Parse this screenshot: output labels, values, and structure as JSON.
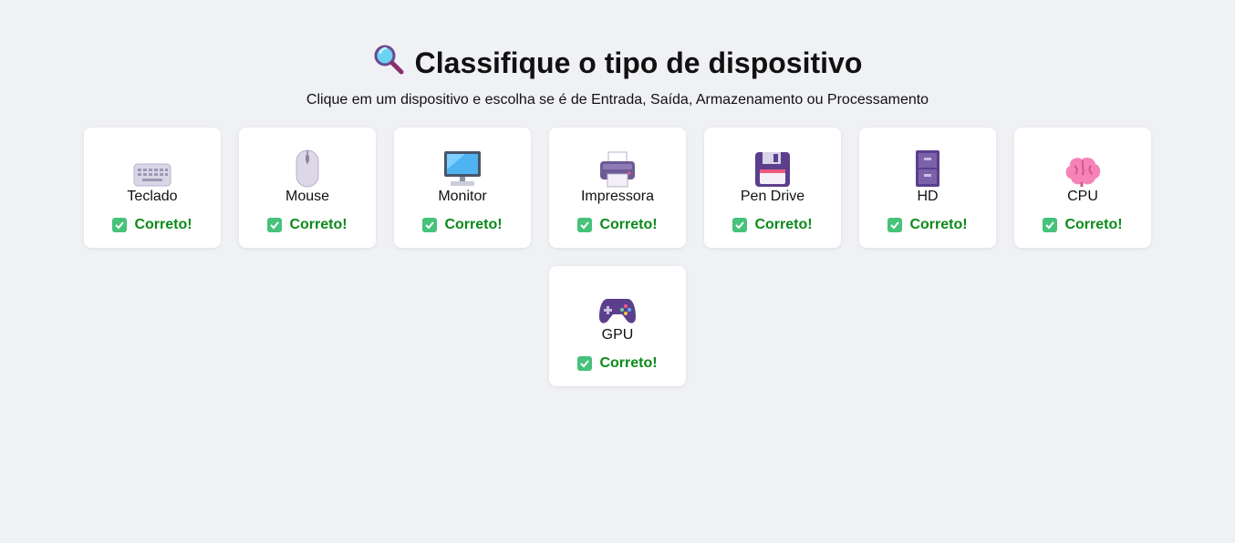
{
  "header": {
    "icon": "magnifier-icon",
    "title": "Classifique o tipo de dispositivo",
    "subtitle": "Clique em um dispositivo e escolha se é de Entrada, Saída, Armazenamento ou Processamento"
  },
  "status_color": "#0b8a1a",
  "devices": [
    {
      "label": "Teclado",
      "icon": "keyboard-icon",
      "status": "Correto!"
    },
    {
      "label": "Mouse",
      "icon": "mouse-icon",
      "status": "Correto!"
    },
    {
      "label": "Monitor",
      "icon": "monitor-icon",
      "status": "Correto!"
    },
    {
      "label": "Impressora",
      "icon": "printer-icon",
      "status": "Correto!"
    },
    {
      "label": "Pen Drive",
      "icon": "floppy-disk-icon",
      "status": "Correto!"
    },
    {
      "label": "HD",
      "icon": "file-cabinet-icon",
      "status": "Correto!"
    },
    {
      "label": "CPU",
      "icon": "brain-icon",
      "status": "Correto!"
    },
    {
      "label": "GPU",
      "icon": "gamepad-icon",
      "status": "Correto!"
    }
  ]
}
